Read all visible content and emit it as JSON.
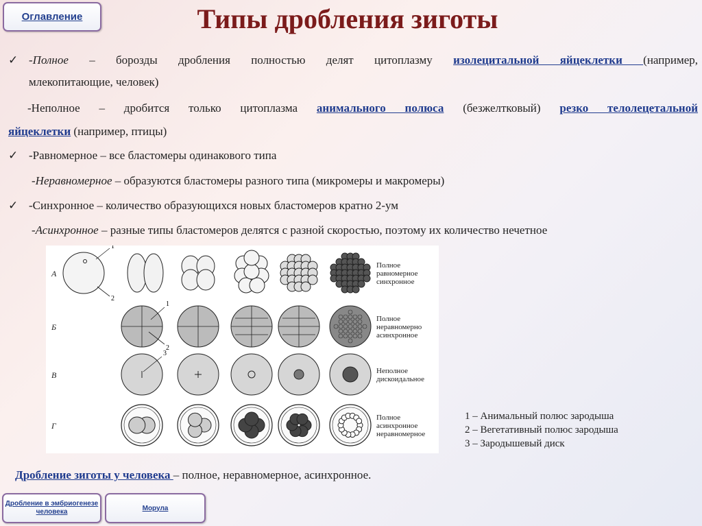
{
  "nav": {
    "toc": "Оглавление",
    "bottom_left": "Дробление в эмбриогенезе человека",
    "bottom_right": "Морула"
  },
  "title": "Типы дробления зиготы",
  "lines": {
    "l1_lead": "-Полное",
    "l1_dash": " – ",
    "l1_text": "борозды дробления полностью делят цитоплазму",
    "l1_link": "изолецитальной яйцеклетки ",
    "l1_tail": "(например,",
    "l1_cont": "млекопитающие, человек)",
    "l2_text": "-Неполное – дробится только цитоплазма",
    "l2_link1": "анимального полюса",
    "l2_mid": "(безжелтковый)",
    "l2_link2a": "резко телолецетальной",
    "l2_link2b": "яйцеклетки",
    "l2_tail": " (например, птицы)",
    "l3": "-Равномерное – все бластомеры одинакового типа",
    "l4_lead": "-Неравномерное",
    "l4_text": " – образуются бластомеры разного типа (микромеры и макромеры)",
    "l5": "-Синхронное – количество образующихся новых бластомеров кратно 2-ум",
    "l6_lead": "-Асинхронное",
    "l6_text": " – разные типы бластомеров делятся с разной скоростью, поэтому их количество нечетное"
  },
  "figure": {
    "rows": [
      "А",
      "Б",
      "В",
      "Г"
    ],
    "row_labels": [
      [
        "Полное",
        "равномерное",
        "синхронное"
      ],
      [
        "Полное",
        "неравномерно",
        "асинхронное"
      ],
      [
        "Неполное",
        "дискоидальное"
      ],
      [
        "Полное",
        "асинхронное",
        "неравномерное"
      ]
    ],
    "markers": [
      "1",
      "2",
      "1",
      "2",
      "3"
    ]
  },
  "legend": [
    "1 – Анимальный полюс зародыша",
    "2 – Вегетативный полюс зародыша",
    "3 – Зародышевый диск"
  ],
  "human": {
    "link": "Дробление зиготы у человека ",
    "text": "– полное, неравномерное, асинхронное."
  }
}
